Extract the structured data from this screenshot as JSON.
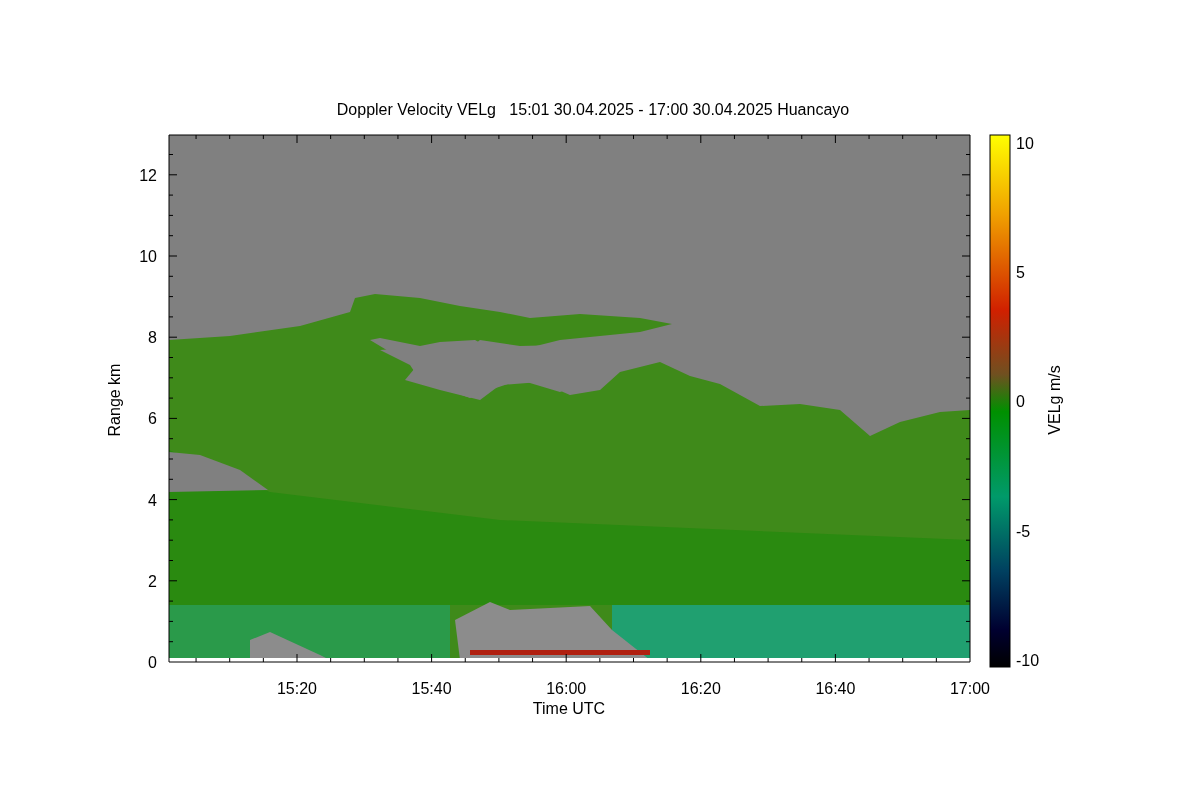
{
  "chart": {
    "title": "Doppler Velocity VELg   15:01 30.04.2025 - 17:00 30.04.2025 Huancayo",
    "xlabel": "Time UTC",
    "ylabel": "Range km",
    "xtick_labels": [
      "15:20",
      "15:40",
      "16:00",
      "16:20",
      "16:40",
      "17:00"
    ],
    "ytick_labels": [
      "12",
      "10",
      "8",
      "6",
      "4",
      "2",
      "0"
    ]
  },
  "colorbar": {
    "label": "VELg m/s",
    "tick_labels": [
      "10",
      "5",
      "0",
      "-5",
      "-10"
    ]
  }
}
